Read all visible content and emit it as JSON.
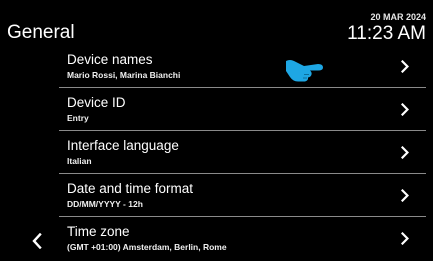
{
  "header": {
    "title": "General",
    "date": "20 MAR 2024",
    "time": "11:23 AM"
  },
  "menu": {
    "items": [
      {
        "title": "Device names",
        "value": "Mario Rossi, Marina Bianchi",
        "icon": "chevron-right-icon"
      },
      {
        "title": "Device ID",
        "value": "Entry",
        "icon": "chevron-right-icon"
      },
      {
        "title": "Interface language",
        "value": "Italian",
        "icon": "chevron-right-icon"
      },
      {
        "title": "Date and time format",
        "value": "DD/MM/YYYY - 12h",
        "icon": "chevron-right-icon"
      },
      {
        "title": "Time zone",
        "value": "(GMT +01:00) Amsterdam, Berlin, Rome",
        "icon": "chevron-right-icon"
      }
    ]
  },
  "navigation": {
    "back_icon": "chevron-left-icon"
  },
  "cursor": {
    "icon": "pointing-hand-icon",
    "color": "#1ea7e4"
  },
  "colors": {
    "background": "#000000",
    "text": "#ffffff",
    "divider": "#8a8a8a",
    "accent": "#1ea7e4"
  }
}
